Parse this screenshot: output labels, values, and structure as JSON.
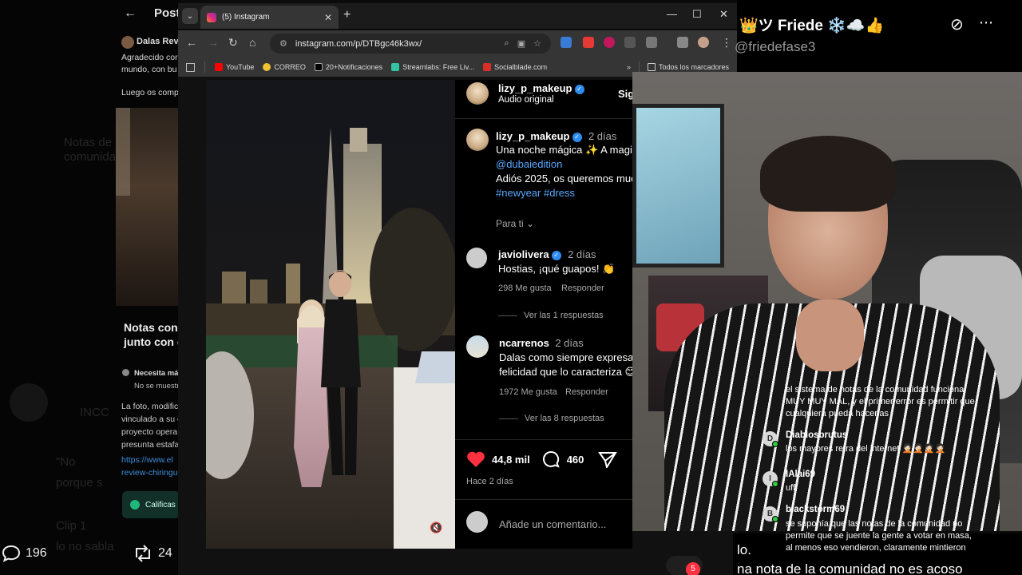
{
  "x_post": {
    "back_arrow": "←",
    "title": "Post",
    "author": "Dalas Revi",
    "lines": [
      "Agradecido cor",
      "mundo, con bu",
      "Luego os comp"
    ],
    "notes_title_1": "Notas con",
    "notes_title_2": "junto con c",
    "needs_more": "Necesita más",
    "not_shown": "No se muestr",
    "para": [
      "La foto, modific",
      "vinculado a su c",
      "proyecto opera",
      "presunta estafa"
    ],
    "links": [
      "https://www.el",
      "review-chiringu"
    ],
    "rate_button": "Calificas",
    "replies_count": "196",
    "reposts_count": "24",
    "ghost_texts": [
      "Notas de la",
      "comunidad",
      "Clip 1",
      "lo no sabla",
      "porque s",
      "\"No",
      "INCC"
    ]
  },
  "browser": {
    "tab_title": "(5) Instagram",
    "url": "instagram.com/p/DTBgc46k3wx/",
    "new_tab": "+",
    "bookmarks": [
      {
        "label": "YouTube",
        "color": "#ff0000"
      },
      {
        "label": "CORREO",
        "color": "#f1c232"
      },
      {
        "label": "20+Notificaciones",
        "color": "#ffffff"
      },
      {
        "label": "Streamlabs: Free Liv...",
        "color": "#31c3a2"
      },
      {
        "label": "Socialblade.com",
        "color": "#d93025"
      }
    ],
    "all_bookmarks": "Todos los marcadores"
  },
  "instagram": {
    "header_user": "lizy_p_makeup",
    "header_sub": "Audio original",
    "follow_cut": "Sig",
    "caption": {
      "user": "lizy_p_makeup",
      "time": "2 días",
      "line1": "Una noche mágica ✨ A magi",
      "mention": "@dubaiedition",
      "line3": "Adiós 2025, os queremos muc",
      "hashtags": "#newyear #dress"
    },
    "for_you": "Para ti",
    "comments": [
      {
        "user": "javiolivera",
        "verified": true,
        "time": "2 días",
        "text": "Hostias, ¡qué guapos! 👏",
        "likes": "298 Me gusta",
        "reply": "Responder",
        "view_replies": "Ver las 1 respuestas"
      },
      {
        "user": "ncarrenos",
        "verified": false,
        "time": "2 días",
        "text": "Dalas como siempre expresar",
        "text2": "felicidad que lo caracteriza 😊",
        "likes": "1972 Me gusta",
        "reply": "Responder",
        "view_replies": "Ver las 8 respuestas"
      }
    ],
    "likes_count": "44,8 mil",
    "comments_count": "460",
    "posted": "Hace 2 días",
    "comment_placeholder": "Añade un comentario...",
    "notif_count": "5"
  },
  "streamer": {
    "name": "Friede",
    "handle": "@friedefase3"
  },
  "chat": [
    {
      "user": "",
      "initial": "",
      "lines": [
        "el sistema de notas de la comunidad funciona",
        "MUY MUY MAL, y el primer error es permitir que",
        "cualquiera pueda hacerlas"
      ]
    },
    {
      "user": "Diablosbrutus",
      "initial": "D",
      "lines": [
        "los mayores retra del internet 🤦🏻🤦🏻🤦🏻🤦🏻"
      ]
    },
    {
      "user": "IAlai69",
      "initial": "I",
      "lines": [
        "ufff"
      ]
    },
    {
      "user": "blackstorm69",
      "initial": "B",
      "lines": [
        "se suponía que las notas de la comunidad no",
        "permite que se juente la gente a votar en masa,",
        "al menos eso vendieron, claramente mintieron"
      ]
    }
  ],
  "captions": {
    "line_a": "lo.",
    "line_b": "na nota de la comunidad no es acoso"
  }
}
